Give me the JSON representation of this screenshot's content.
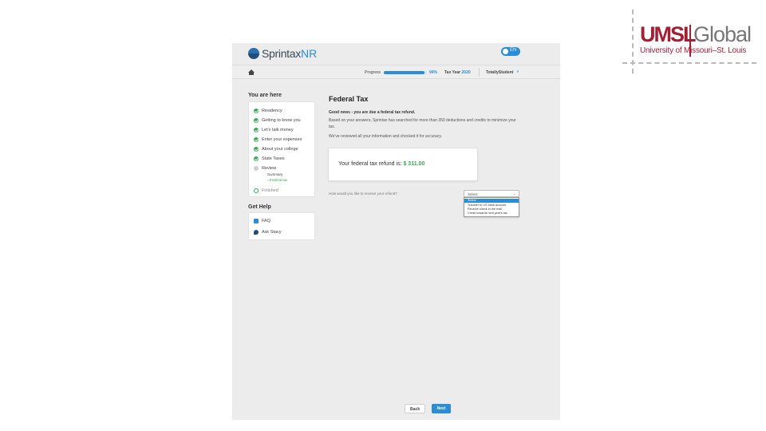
{
  "logo": {
    "main": "UMSL",
    "secondary": "Global",
    "subtitle": "University of Missouri–St. Louis",
    "colors": {
      "red": "#a31f34",
      "gray": "#777777"
    }
  },
  "app": {
    "brand": "Sprintax",
    "brand_suffix": "NR",
    "toggle_label": "EN",
    "accent_color": "#2a8dd6",
    "success_color": "#3aa655"
  },
  "topbar": {
    "home_icon": "home-icon",
    "progress_label": "Progress",
    "progress_percent": 94,
    "progress_text": "94%",
    "tax_year_label": "Tax Year",
    "tax_year_value": "2020",
    "user": "TotallyStudent",
    "user_chevron": "∨"
  },
  "sidebar": {
    "you_are_here_title": "You are here",
    "items": [
      {
        "label": "Residency",
        "state": "done"
      },
      {
        "label": "Getting to know you",
        "state": "done"
      },
      {
        "label": "Let's talk money",
        "state": "done"
      },
      {
        "label": "Enter your expenses",
        "state": "done"
      },
      {
        "label": "About your college",
        "state": "done"
      },
      {
        "label": "State Taxes",
        "state": "done"
      },
      {
        "label": "Review",
        "state": "current"
      }
    ],
    "review_sub": [
      {
        "label": "Summary"
      },
      {
        "label": "› Federal tax"
      }
    ],
    "finished_label": "Finished",
    "get_help_title": "Get Help",
    "help_items": [
      {
        "label": "FAQ",
        "icon": "faq-icon"
      },
      {
        "label": "Ask Stacy",
        "icon": "chat-icon"
      }
    ]
  },
  "main": {
    "title": "Federal Tax",
    "good_news": "Good news - you are due a federal tax refund.",
    "paragraph": "Based on your answers, Sprintax has searched for more than 350 deductions and credits to minimize your tax.",
    "paragraph2": "We've reviewed all your information and checked it for accuracy.",
    "refund_label": "Your federal tax refund is:",
    "refund_amount": "$ 311.00",
    "receive_question": "How would you like to receive your refund?",
    "select": {
      "value": "Select",
      "chevron": "⌄",
      "options": [
        "Select",
        "Transfer to US bank account",
        "Receive check in the mail",
        "Credit towards next year's tax"
      ],
      "selected_index": 0
    }
  },
  "footer": {
    "back_label": "Back",
    "next_label": "Next"
  }
}
